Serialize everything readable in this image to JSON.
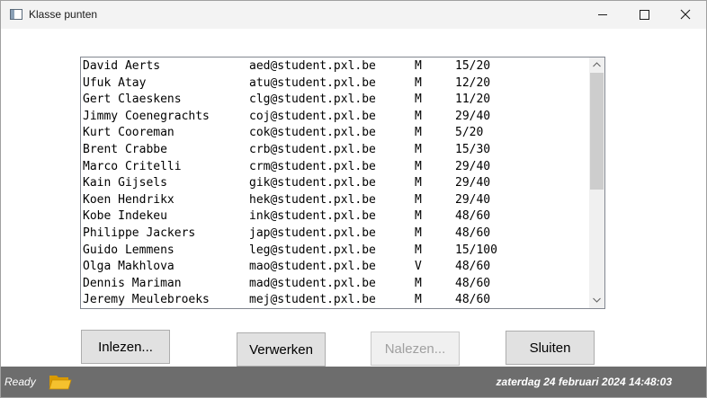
{
  "window": {
    "title": "Klasse punten"
  },
  "students": [
    {
      "name": "David Aerts",
      "email": "aed@student.pxl.be",
      "sex": "M",
      "score": "15/20"
    },
    {
      "name": "Ufuk Atay",
      "email": "atu@student.pxl.be",
      "sex": "M",
      "score": "12/20"
    },
    {
      "name": "Gert Claeskens",
      "email": "clg@student.pxl.be",
      "sex": "M",
      "score": "11/20"
    },
    {
      "name": "Jimmy Coenegrachts",
      "email": "coj@student.pxl.be",
      "sex": "M",
      "score": "29/40"
    },
    {
      "name": "Kurt Cooreman",
      "email": "cok@student.pxl.be",
      "sex": "M",
      "score": "5/20"
    },
    {
      "name": "Brent Crabbe",
      "email": "crb@student.pxl.be",
      "sex": "M",
      "score": "15/30"
    },
    {
      "name": "Marco Critelli",
      "email": "crm@student.pxl.be",
      "sex": "M",
      "score": "29/40"
    },
    {
      "name": "Kain Gijsels",
      "email": "gik@student.pxl.be",
      "sex": "M",
      "score": "29/40"
    },
    {
      "name": "Koen Hendrikx",
      "email": "hek@student.pxl.be",
      "sex": "M",
      "score": "29/40"
    },
    {
      "name": "Kobe Indekeu",
      "email": "ink@student.pxl.be",
      "sex": "M",
      "score": "48/60"
    },
    {
      "name": "Philippe Jackers",
      "email": "jap@student.pxl.be",
      "sex": "M",
      "score": "48/60"
    },
    {
      "name": "Guido Lemmens",
      "email": "leg@student.pxl.be",
      "sex": "M",
      "score": "15/100"
    },
    {
      "name": "Olga Makhlova",
      "email": "mao@student.pxl.be",
      "sex": "V",
      "score": "48/60"
    },
    {
      "name": "Dennis Mariman",
      "email": "mad@student.pxl.be",
      "sex": "M",
      "score": "48/60"
    },
    {
      "name": "Jeremy Meulebroeks",
      "email": "mej@student.pxl.be",
      "sex": "M",
      "score": "48/60"
    }
  ],
  "buttons": {
    "inlezen": "Inlezen...",
    "verwerken": "Verwerken",
    "nalezen": "Nalezen...",
    "sluiten": "Sluiten"
  },
  "status": {
    "text": "Ready",
    "datetime": "zaterdag 24 februari 2024 14:48:03",
    "icon": "folder-icon"
  },
  "colors": {
    "statusbar": "#6d6d6d",
    "folder": "#f5b700"
  }
}
